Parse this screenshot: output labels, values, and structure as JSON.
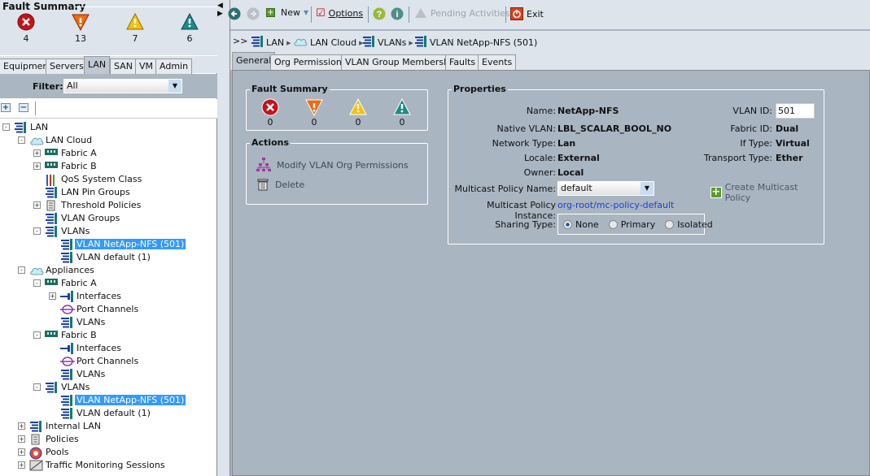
{
  "fault_summary": {
    "title": "Fault Summary",
    "critical": "4",
    "major": "13",
    "minor": "7",
    "warning": "6"
  },
  "nav_tabs": [
    "Equipment",
    "Servers",
    "LAN",
    "SAN",
    "VM",
    "Admin"
  ],
  "filter": {
    "label": "Filter:",
    "value": "All"
  },
  "tree": [
    {
      "label": "LAN",
      "level": 0,
      "exp": "-",
      "icon": "vlan"
    },
    {
      "label": "LAN Cloud",
      "level": 1,
      "exp": "-",
      "icon": "cloud"
    },
    {
      "label": "Fabric A",
      "level": 2,
      "exp": "+",
      "icon": "fabric"
    },
    {
      "label": "Fabric B",
      "level": 2,
      "exp": "+",
      "icon": "fabric"
    },
    {
      "label": "QoS System Class",
      "level": 2,
      "exp": "",
      "icon": "qos"
    },
    {
      "label": "LAN Pin Groups",
      "level": 2,
      "exp": "",
      "icon": "vlan"
    },
    {
      "label": "Threshold Policies",
      "level": 2,
      "exp": "+",
      "icon": "scroll"
    },
    {
      "label": "VLAN Groups",
      "level": 2,
      "exp": "",
      "icon": "vlan"
    },
    {
      "label": "VLANs",
      "level": 2,
      "exp": "-",
      "icon": "vlan"
    },
    {
      "label": "VLAN NetApp-NFS (501)",
      "level": 3,
      "exp": "",
      "icon": "vlan",
      "selected": true
    },
    {
      "label": "VLAN default (1)",
      "level": 3,
      "exp": "",
      "icon": "vlan"
    },
    {
      "label": "Appliances",
      "level": 1,
      "exp": "-",
      "icon": "cloud"
    },
    {
      "label": "Fabric A",
      "level": 2,
      "exp": "-",
      "icon": "fabric"
    },
    {
      "label": "Interfaces",
      "level": 3,
      "exp": "+",
      "icon": "iface"
    },
    {
      "label": "Port Channels",
      "level": 3,
      "exp": "",
      "icon": "portch"
    },
    {
      "label": "VLANs",
      "level": 3,
      "exp": "",
      "icon": "vlan"
    },
    {
      "label": "Fabric B",
      "level": 2,
      "exp": "-",
      "icon": "fabric"
    },
    {
      "label": "Interfaces",
      "level": 3,
      "exp": "",
      "icon": "iface"
    },
    {
      "label": "Port Channels",
      "level": 3,
      "exp": "",
      "icon": "portch"
    },
    {
      "label": "VLANs",
      "level": 3,
      "exp": "",
      "icon": "vlan"
    },
    {
      "label": "VLANs",
      "level": 2,
      "exp": "-",
      "icon": "vlan"
    },
    {
      "label": "VLAN NetApp-NFS (501)",
      "level": 3,
      "exp": "",
      "icon": "vlan",
      "selected": true
    },
    {
      "label": "VLAN default (1)",
      "level": 3,
      "exp": "",
      "icon": "vlan"
    },
    {
      "label": "Internal LAN",
      "level": 1,
      "exp": "+",
      "icon": "vlan"
    },
    {
      "label": "Policies",
      "level": 1,
      "exp": "+",
      "icon": "scroll"
    },
    {
      "label": "Pools",
      "level": 1,
      "exp": "+",
      "icon": "pools"
    },
    {
      "label": "Traffic Monitoring Sessions",
      "level": 1,
      "exp": "+",
      "icon": "traffic"
    }
  ],
  "toolbar": {
    "new": "New",
    "options": "Options",
    "pending": "Pending Activities",
    "exit": "Exit"
  },
  "breadcrumb": {
    "prefix": ">>",
    "items": [
      "LAN",
      "LAN Cloud",
      "VLANs",
      "VLAN NetApp-NFS (501)"
    ]
  },
  "tabs": [
    "General",
    "Org Permissions",
    "VLAN Group Membership",
    "Faults",
    "Events"
  ],
  "detail_faults": {
    "title": "Fault Summary",
    "critical": "0",
    "major": "0",
    "minor": "0",
    "warning": "0"
  },
  "actions": {
    "title": "Actions",
    "modify": "Modify VLAN Org Permissions",
    "delete": "Delete"
  },
  "properties": {
    "title": "Properties",
    "name_label": "Name:",
    "name": "NetApp-NFS",
    "native_label": "Native VLAN:",
    "native": "LBL_SCALAR_BOOL_NO",
    "nettype_label": "Network Type:",
    "nettype": "Lan",
    "locale_label": "Locale:",
    "locale": "External",
    "owner_label": "Owner:",
    "owner": "Local",
    "mcast_name_label": "Multicast Policy Name:",
    "mcast_name": "default",
    "mcast_inst_label": "Multicast Policy Instance:",
    "mcast_inst": "org-root/mc-policy-default",
    "sharing_label": "Sharing Type:",
    "sharing_options": [
      "None",
      "Primary",
      "Isolated"
    ],
    "sharing_selected": "None",
    "vlanid_label": "VLAN ID:",
    "vlanid": "501",
    "fabric_label": "Fabric ID:",
    "fabric": "Dual",
    "iftype_label": "If Type:",
    "iftype": "Virtual",
    "transport_label": "Transport Type:",
    "transport": "Ether",
    "create_mcast": "Create Multicast Policy"
  }
}
